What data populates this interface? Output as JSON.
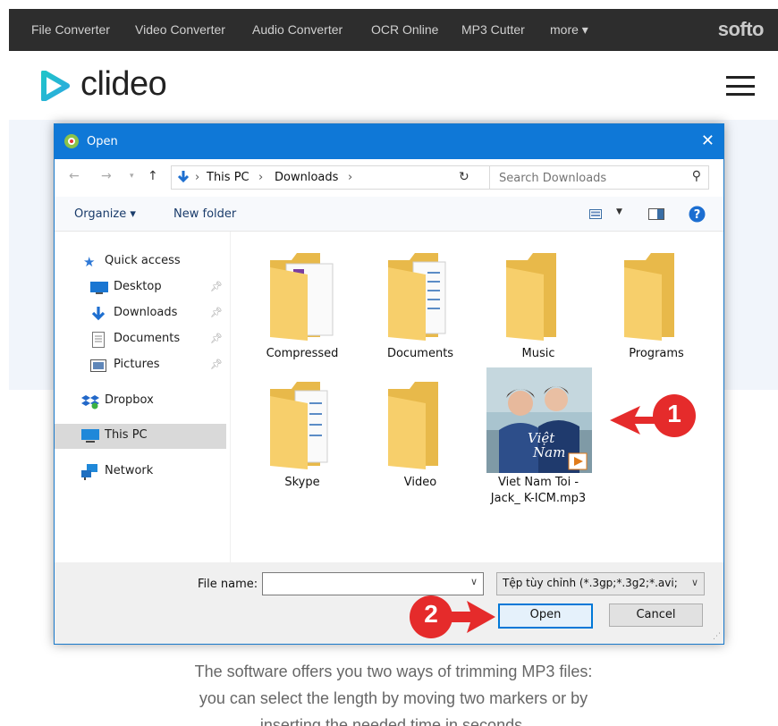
{
  "topnav": {
    "links": [
      "File Converter",
      "Video Converter",
      "Audio Converter",
      "OCR Online",
      "MP3 Cutter",
      "more ▾"
    ],
    "brand": "softo"
  },
  "header": {
    "logo_text": "clideo"
  },
  "dialog": {
    "title": "Open",
    "close": "✕",
    "path": [
      "This PC",
      "Downloads"
    ],
    "search_placeholder": "Search Downloads",
    "organize": "Organize ▾",
    "new_folder": "New folder",
    "nav": [
      {
        "label": "Quick access",
        "icon": "star-icon"
      },
      {
        "label": "Desktop",
        "icon": "desktop-icon",
        "pinned": true
      },
      {
        "label": "Downloads",
        "icon": "download-icon",
        "pinned": true
      },
      {
        "label": "Documents",
        "icon": "document-icon",
        "pinned": true
      },
      {
        "label": "Pictures",
        "icon": "pictures-icon",
        "pinned": true
      },
      {
        "label": "Dropbox",
        "icon": "dropbox-icon"
      },
      {
        "label": "This PC",
        "icon": "computer-icon",
        "selected": true
      },
      {
        "label": "Network",
        "icon": "network-icon"
      }
    ],
    "files": [
      "Compressed",
      "Documents",
      "Music",
      "Programs",
      "Skype",
      "Video"
    ],
    "mp3_file": {
      "line1": "Viet Nam Toi -",
      "line2": "Jack_ K-ICM.mp3"
    },
    "file_name_label": "File name:",
    "file_name_value": "",
    "file_type": "Tệp tùy chỉnh (*.3gp;*.3g2;*.avi;",
    "open_button": "Open",
    "cancel_button": "Cancel"
  },
  "callouts": {
    "one": "1",
    "two": "2"
  },
  "body_text": [
    "The software offers you two ways of trimming MP3 files:",
    "you can select the length by moving two markers or by",
    "inserting the needed time in seconds."
  ],
  "colors": {
    "accent": "#0f78d7",
    "callout": "#e52b2b",
    "topnav": "#2d2d2d",
    "folder": "#f7cf6b"
  }
}
